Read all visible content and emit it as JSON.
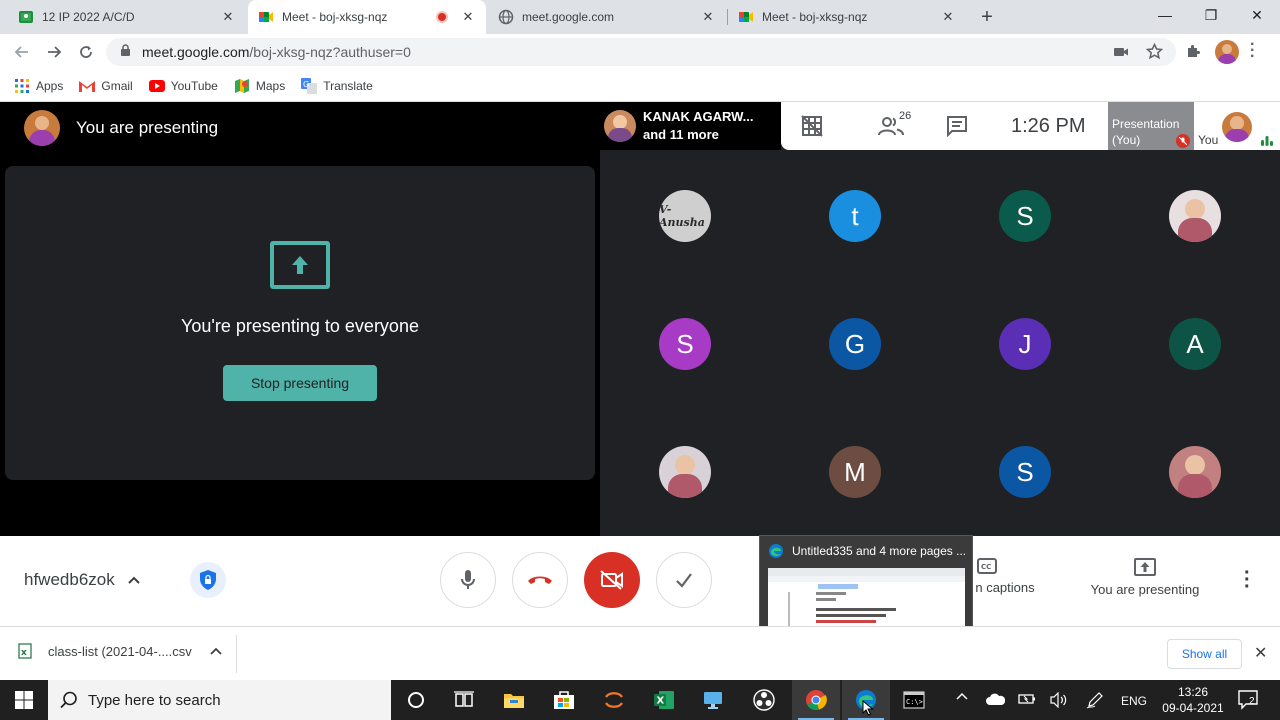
{
  "browser": {
    "tabs": [
      {
        "title": "12 IP 2022 A/C/D",
        "active": false
      },
      {
        "title": "Meet - boj-xksg-nqz",
        "active": true,
        "recording": true
      },
      {
        "title": "meet.google.com",
        "active": false
      },
      {
        "title": "Meet - boj-xksg-nqz",
        "active": false
      }
    ],
    "new_tab": "+",
    "window_controls": {
      "minimize": "—",
      "restore": "❐",
      "close": "✕"
    },
    "omnibox": {
      "host": "meet.google.com",
      "path": "/boj-xksg-nqz?authuser=0"
    },
    "bookmarks": [
      "Apps",
      "Gmail",
      "YouTube",
      "Maps",
      "Translate"
    ]
  },
  "meet": {
    "presenting_header": "You are presenting",
    "present_title": "You're presenting to everyone",
    "stop_button": "Stop presenting",
    "top_bar": {
      "speaker_name": "KANAK AGARW...",
      "speaker_more": "and 11 more",
      "people_count": "26",
      "time": "1:26 PM",
      "presentation_label": "Presentation",
      "presentation_sub": "(You)",
      "you_label": "You"
    },
    "participants": [
      {
        "letter": "",
        "label": "V-Anusha",
        "color": "#cfcfcf",
        "photo": true
      },
      {
        "letter": "t",
        "color": "#1a8fe0"
      },
      {
        "letter": "S",
        "color": "#0b5b4c"
      },
      {
        "letter": "",
        "color": "#e8e0e0",
        "photo": true
      },
      {
        "letter": "S",
        "color": "#a83bc5"
      },
      {
        "letter": "G",
        "color": "#0b57a4"
      },
      {
        "letter": "J",
        "color": "#5b2fb5"
      },
      {
        "letter": "A",
        "color": "#0d5446"
      },
      {
        "letter": "",
        "color": "#d8d2d8",
        "photo": true
      },
      {
        "letter": "M",
        "color": "#6d4c41"
      },
      {
        "letter": "S",
        "color": "#0b57a4"
      },
      {
        "letter": "",
        "color": "#c28080",
        "photo": true
      }
    ],
    "meeting_code": "hfwedb6zok",
    "controls": {
      "captions_label": "n captions",
      "presenting_label": "You are presenting"
    }
  },
  "preview": {
    "title": "Untitled335 and 4 more pages ..."
  },
  "download": {
    "file": "class-list (2021-04-....csv",
    "show_all": "Show all"
  },
  "taskbar": {
    "search_placeholder": "Type here to search",
    "lang": "ENG",
    "time": "13:26",
    "date": "09-04-2021",
    "notifications": "2"
  }
}
